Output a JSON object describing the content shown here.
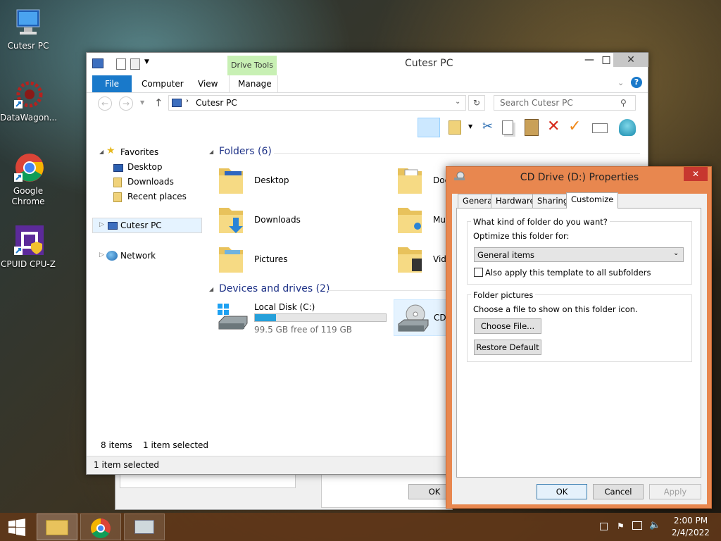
{
  "desktop": {
    "icons": [
      {
        "label": "Cutesr PC",
        "icon": "computer-icon"
      },
      {
        "label": "DataWagon...",
        "icon": "datawagon-icon"
      },
      {
        "label": "Google Chrome",
        "icon": "chrome-icon"
      },
      {
        "label": "CPUID CPU-Z",
        "icon": "cpuz-icon"
      }
    ]
  },
  "explorer": {
    "title": "Cutesr PC",
    "context_tab_group": "Drive Tools",
    "tabs": [
      "File",
      "Computer",
      "View",
      "Manage"
    ],
    "address": "Cutesr PC",
    "search_placeholder": "Search Cutesr PC",
    "nav": {
      "favorites": "Favorites",
      "fav_items": [
        "Desktop",
        "Downloads",
        "Recent places"
      ],
      "this_pc": "Cutesr PC",
      "network": "Network"
    },
    "folders_header": "Folders (6)",
    "folders": [
      "Desktop",
      "Documents",
      "Downloads",
      "Music",
      "Pictures",
      "Videos"
    ],
    "folders_visible": [
      "Desktop",
      "Doc",
      "Downloads",
      "Mu",
      "Pictures",
      "Vide"
    ],
    "devices_header": "Devices and drives (2)",
    "drives": [
      {
        "name": "Local Disk (C:)",
        "free": "99.5 GB free of 119 GB",
        "used_fraction": 0.16
      },
      {
        "name": "CD"
      }
    ],
    "status_items": "8 items",
    "status_selected": "1 item selected",
    "status_bar": "1 item selected"
  },
  "background_dialog": {
    "ok_label": "OK"
  },
  "properties": {
    "title": "CD Drive (D:) Properties",
    "tabs": [
      "General",
      "Hardware",
      "Sharing",
      "Customize"
    ],
    "active_tab": "Customize",
    "group1_title": "What kind of folder do you want?",
    "optimize_label": "Optimize this folder for:",
    "optimize_value": "General items",
    "apply_subfolders": "Also apply this template to all subfolders",
    "apply_subfolders_checked": false,
    "group2_title": "Folder pictures",
    "choose_text": "Choose a file to show on this folder icon.",
    "choose_button": "Choose File...",
    "restore_button": "Restore Default",
    "ok": "OK",
    "cancel": "Cancel",
    "apply": "Apply"
  },
  "taskbar": {
    "time": "2:00 PM",
    "date": "2/4/2022"
  },
  "colors": {
    "accent_blue": "#1979ca",
    "drive_tools": "#c8f0b4",
    "dialog_frame": "#e8874f",
    "group_header": "#1e3287"
  }
}
